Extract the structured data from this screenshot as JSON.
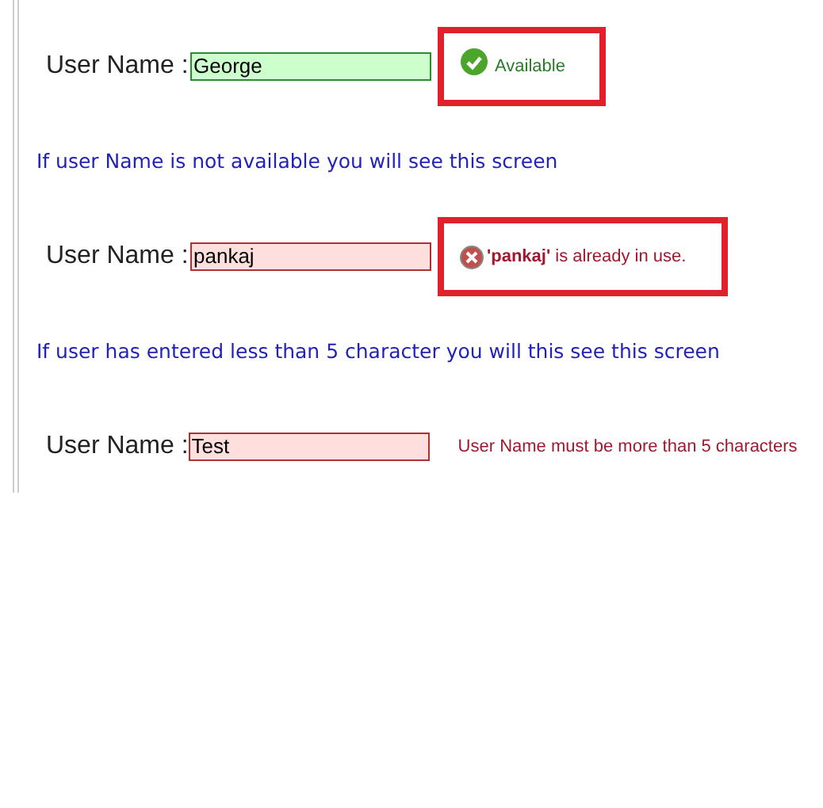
{
  "items": [
    {
      "kind": "available",
      "label": "User Name :",
      "value": "George",
      "message": "Available",
      "highlighted": true
    },
    {
      "kind": "hint",
      "text": "If user Name is not available you will see this screen"
    },
    {
      "kind": "taken",
      "label": "User Name :",
      "value": "pankaj",
      "message": "**'pankaj'** is already in use.",
      "highlighted": true
    },
    {
      "kind": "hint",
      "text": "If user has entered less than 5 character you will this see this screen"
    },
    {
      "kind": "too_short",
      "label": "User Name :",
      "value": "Test",
      "message": "User Name must be more than 5 characters",
      "highlighted": false
    }
  ]
}
